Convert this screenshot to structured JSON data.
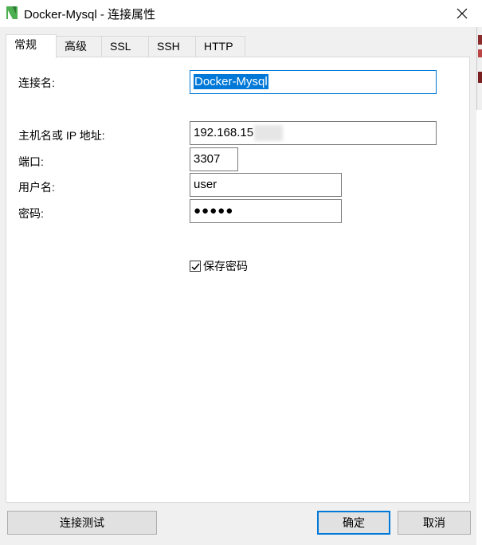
{
  "window": {
    "title": "Docker-Mysql - 连接属性"
  },
  "tabs": [
    {
      "label": "常规",
      "active": true
    },
    {
      "label": "高级",
      "active": false
    },
    {
      "label": "SSL",
      "active": false
    },
    {
      "label": "SSH",
      "active": false
    },
    {
      "label": "HTTP",
      "active": false
    }
  ],
  "form": {
    "connection_name": {
      "label": "连接名:",
      "value": "Docker-Mysql"
    },
    "host": {
      "label": "主机名或 IP 地址:",
      "value": "192.168.15"
    },
    "port": {
      "label": "端口:",
      "value": "3307"
    },
    "username": {
      "label": "用户名:",
      "value": "user"
    },
    "password": {
      "label": "密码:",
      "value": "●●●●●"
    },
    "save_password": {
      "label": "保存密码",
      "checked": true
    }
  },
  "buttons": {
    "test_connection": "连接测试",
    "ok": "确定",
    "cancel": "取消"
  },
  "colors": {
    "accent": "#0078d7",
    "logo_green": "#4caf50"
  },
  "icons": {
    "app_logo": "navicat-logo-icon",
    "close": "close-icon",
    "checkbox": "checkmark-icon"
  }
}
